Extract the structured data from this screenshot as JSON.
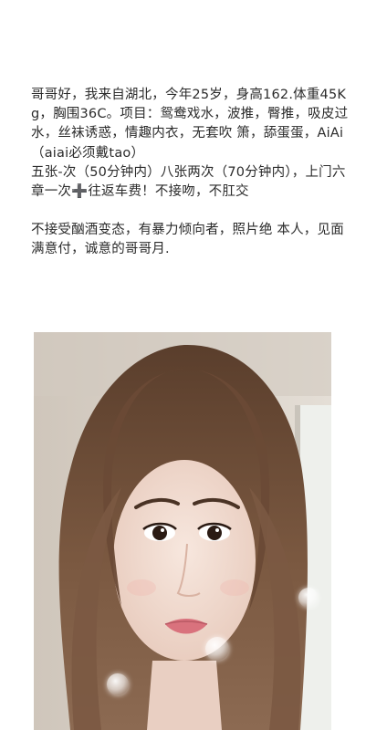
{
  "post": {
    "paragraphs": [
      "哥哥好，我来自湖北，今年25岁，身高162.体重45Kg，胸围36C。项目：鸳鸯戏水，波推，臀推，吸皮过水，丝袜诱惑，情趣内衣，无套吹 箫，舔蛋蛋，AiAi（aiai必须戴tao）",
      "五张-次（50分钟内）八张两次（70分钟内），上门六章一次➕往返车费！不接吻，不肛交",
      "不接受酗酒变态，有暴力倾向者，照片绝 本人，见面满意付，诚意的哥哥月."
    ]
  },
  "photo": {
    "subject": "selfie-portrait",
    "hair_color": "#6b4a35",
    "skin_color": "#f1ddd2",
    "wall_color": "#d8d1c7",
    "bubble_count": 3
  }
}
